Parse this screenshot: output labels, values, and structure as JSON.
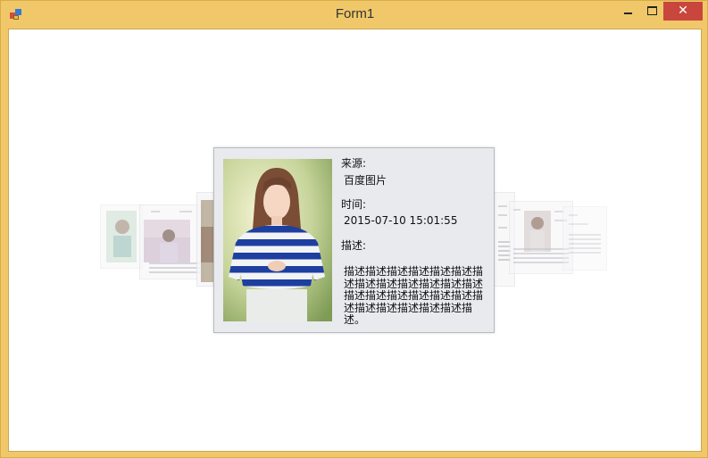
{
  "window": {
    "title": "Form1",
    "close_glyph": "✕",
    "icons": [
      "app-icon",
      "minimize-icon",
      "maximize-icon",
      "close-icon"
    ]
  },
  "card": {
    "source_label": "来源:",
    "source_value": "百度图片",
    "time_label": "时间:",
    "time_value": "2015-07-10 15:01:55",
    "desc_label": "描述:",
    "desc_value": "描述描述描述描述描述描述描述描述描述描述描述描述描述描述描述描述描述描述描述描述描述描述描述描述描述描述。"
  },
  "colors": {
    "frame": "#f0c86a",
    "close_button": "#c9463d",
    "card_background": "#e9eaee",
    "shirt_stripe": "#1d3fa0"
  }
}
